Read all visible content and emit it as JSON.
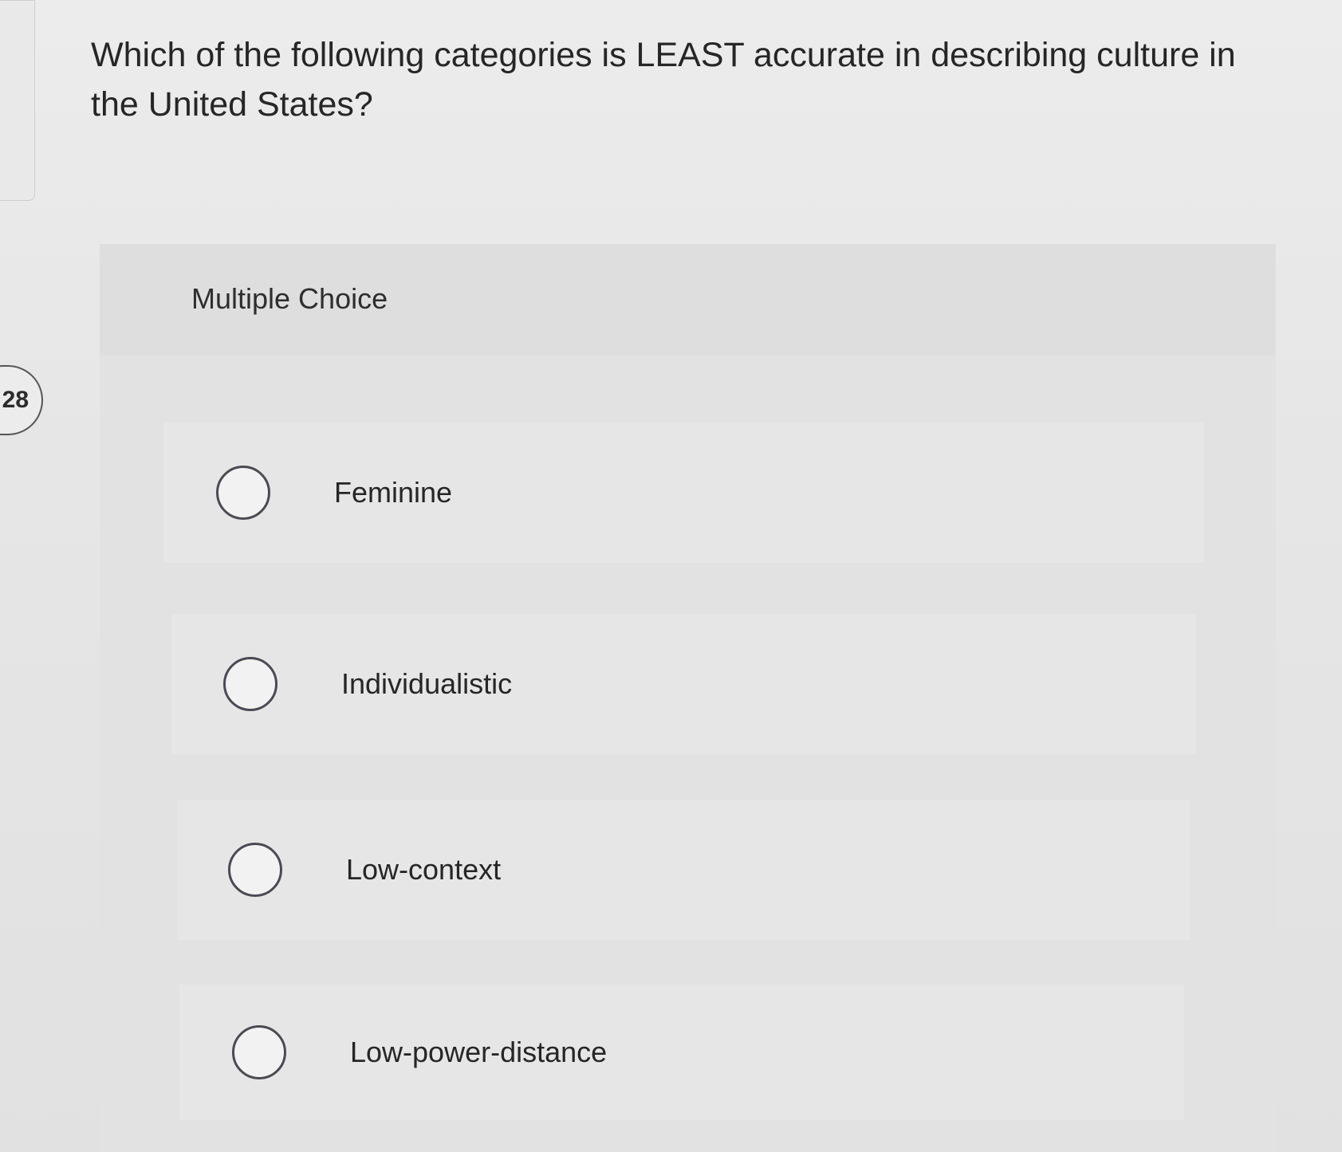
{
  "question": {
    "number_fragment": ":28",
    "text": "Which of the following categories is LEAST accurate in describing culture in the United States?"
  },
  "multiple_choice": {
    "title": "Multiple Choice",
    "options": [
      {
        "label": "Feminine",
        "selected": false
      },
      {
        "label": "Individualistic",
        "selected": false
      },
      {
        "label": "Low-context",
        "selected": false
      },
      {
        "label": "Low-power-distance",
        "selected": false
      }
    ]
  }
}
